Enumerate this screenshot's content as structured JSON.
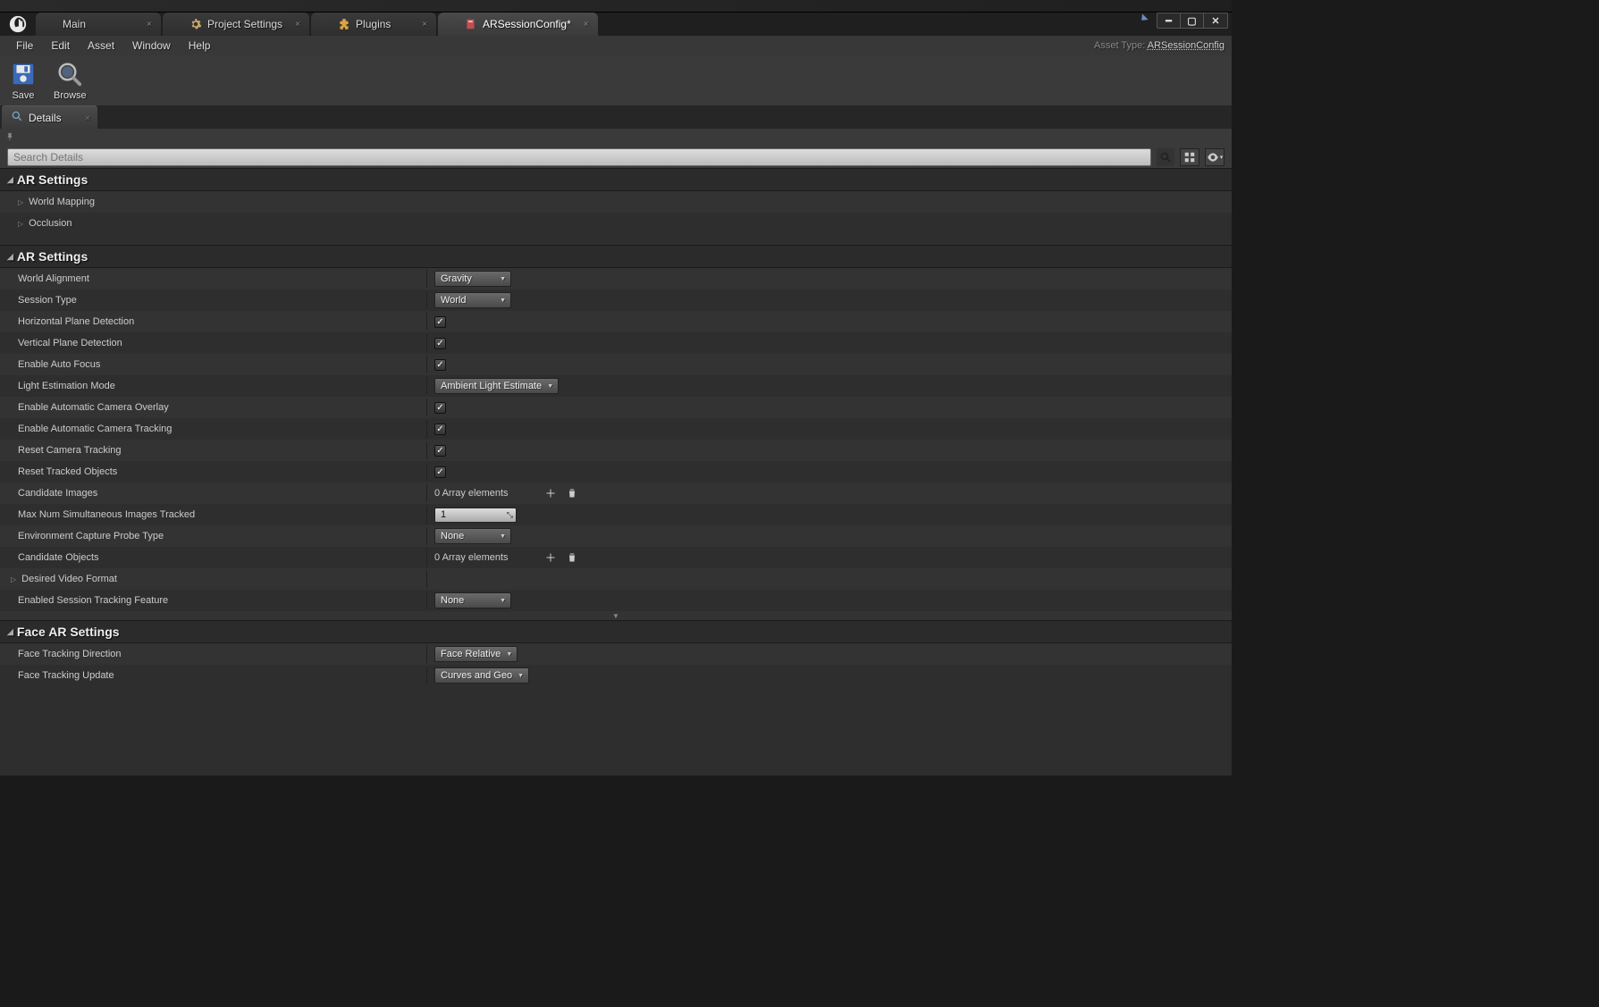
{
  "tabs": [
    {
      "label": "Main"
    },
    {
      "label": "Project Settings"
    },
    {
      "label": "Plugins"
    },
    {
      "label": "ARSessionConfig*"
    }
  ],
  "menus": [
    "File",
    "Edit",
    "Asset",
    "Window",
    "Help"
  ],
  "asset_type_label": "Asset Type:",
  "asset_type_value": "ARSessionConfig",
  "toolbar": {
    "save": "Save",
    "browse": "Browse"
  },
  "panel": {
    "details_label": "Details"
  },
  "search": {
    "placeholder": "Search Details"
  },
  "sections": {
    "ar_settings_1": {
      "title": "AR Settings",
      "rows": [
        "World Mapping",
        "Occlusion"
      ]
    },
    "ar_settings_2": {
      "title": "AR Settings",
      "props": {
        "world_alignment": {
          "label": "World Alignment",
          "value": "Gravity"
        },
        "session_type": {
          "label": "Session Type",
          "value": "World"
        },
        "horizontal_plane": {
          "label": "Horizontal Plane Detection",
          "checked": true
        },
        "vertical_plane": {
          "label": "Vertical Plane Detection",
          "checked": true
        },
        "enable_auto_focus": {
          "label": "Enable Auto Focus",
          "checked": true
        },
        "light_estimation": {
          "label": "Light Estimation Mode",
          "value": "Ambient Light Estimate"
        },
        "auto_cam_overlay": {
          "label": "Enable Automatic Camera Overlay",
          "checked": true
        },
        "auto_cam_tracking": {
          "label": "Enable Automatic Camera Tracking",
          "checked": true
        },
        "reset_cam_tracking": {
          "label": "Reset Camera Tracking",
          "checked": true
        },
        "reset_tracked_obj": {
          "label": "Reset Tracked Objects",
          "checked": true
        },
        "candidate_images": {
          "label": "Candidate Images",
          "array": "0 Array elements"
        },
        "max_images": {
          "label": "Max Num Simultaneous Images Tracked",
          "value": "1"
        },
        "env_probe": {
          "label": "Environment Capture Probe Type",
          "value": "None"
        },
        "candidate_objects": {
          "label": "Candidate Objects",
          "array": "0 Array elements"
        },
        "desired_video": {
          "label": "Desired Video Format"
        },
        "session_tracking_feature": {
          "label": "Enabled Session Tracking Feature",
          "value": "None"
        }
      }
    },
    "face_ar": {
      "title": "Face AR Settings",
      "props": {
        "face_direction": {
          "label": "Face Tracking Direction",
          "value": "Face Relative"
        },
        "face_update": {
          "label": "Face Tracking Update",
          "value": "Curves and Geo"
        }
      }
    }
  }
}
